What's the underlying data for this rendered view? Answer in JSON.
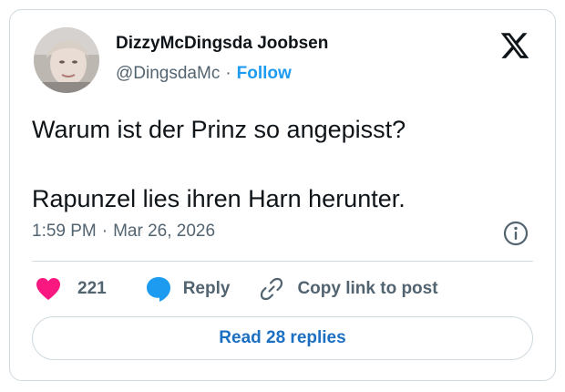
{
  "author": {
    "display_name": "DizzyMcDingsda Joobsen",
    "handle": "@DingsdaMc",
    "separator": "·",
    "follow_label": "Follow"
  },
  "tweet": {
    "line1": "Warum ist der Prinz so angepisst?",
    "line2": "Rapunzel lies ihren Harn herunter."
  },
  "meta": {
    "time": "1:59 PM",
    "separator": "·",
    "date": "Mar 26, 2026"
  },
  "actions": {
    "like_count": "221",
    "reply_label": "Reply",
    "copy_label": "Copy link to post"
  },
  "footer": {
    "read_replies_label": "Read 28 replies"
  },
  "colors": {
    "accent": "#1d9bf0",
    "like": "#f91880",
    "muted": "#536471",
    "text": "#0f1419",
    "border": "#cfd9de"
  },
  "icons": {
    "brand": "x-logo-icon",
    "info": "info-icon",
    "like": "heart-icon",
    "reply": "speech-bubble-icon",
    "copy": "link-icon"
  }
}
